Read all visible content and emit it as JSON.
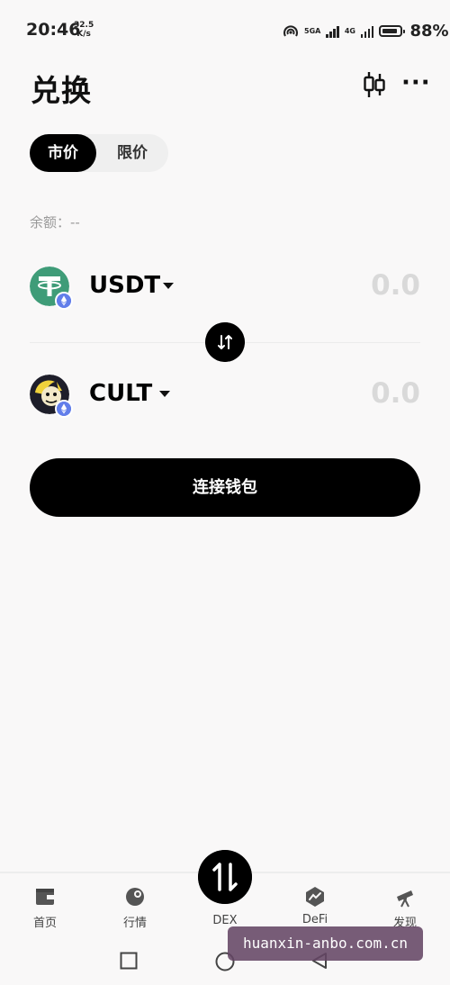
{
  "status_bar": {
    "time": "20:46",
    "speed_value": "32.5",
    "speed_unit": "K/s",
    "net_1": "5GA",
    "net_2": "4G",
    "battery_level": 0.88,
    "battery_text": "88%"
  },
  "header": {
    "title": "兑换",
    "chart_icon": "candlestick-chart-icon",
    "more_icon": "more-dots-icon",
    "more_glyph": "···"
  },
  "tabs": [
    {
      "label": "市价",
      "active": true
    },
    {
      "label": "限价",
      "active": false
    }
  ],
  "balance": {
    "label": "余额：",
    "value": "--"
  },
  "from_token": {
    "symbol": "USDT",
    "amount": "0.0",
    "icon": "tether-icon",
    "chain_badge": "ethereum-icon"
  },
  "to_token": {
    "symbol": "CULT",
    "amount": "0.0",
    "icon": "cult-dao-icon",
    "chain_badge": "ethereum-icon"
  },
  "swap_icon": "swap-arrows-icon",
  "connect_button": {
    "label": "连接钱包"
  },
  "bottom_nav": [
    {
      "label": "首页",
      "icon": "wallet-icon"
    },
    {
      "label": "行情",
      "icon": "market-icon"
    },
    {
      "label": "DEX",
      "icon": "swap-icon",
      "active": true
    },
    {
      "label": "DeFi",
      "icon": "defi-icon"
    },
    {
      "label": "发现",
      "icon": "telescope-icon"
    }
  ],
  "watermark": "huanxin-anbo.com.cn"
}
